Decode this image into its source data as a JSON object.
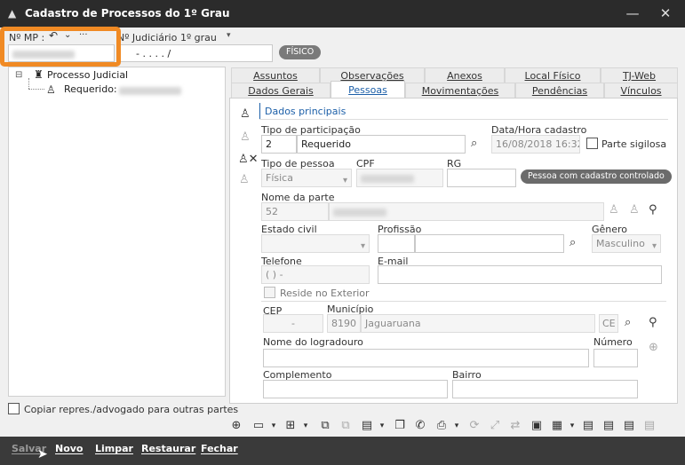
{
  "window": {
    "title": "Cadastro de Processos do 1º Grau",
    "minimize_icon": "minimize-icon",
    "close_icon": "close-icon"
  },
  "header": {
    "mp_label": "Nº MP :",
    "judiciario_label": "Nº Judiciário",
    "grau_value": "1º grau",
    "judiciario_value": "- .  . . .  /",
    "fisico_badge": "FÍSICO"
  },
  "tree": {
    "root": "Processo Judicial",
    "child_label": "Requerido:"
  },
  "tabs_row1": [
    "Assuntos",
    "Observações",
    "Anexos",
    "Local Físico",
    "TJ-Web"
  ],
  "tabs_row2": [
    "Dados Gerais",
    "Pessoas",
    "Movimentações",
    "Pendências",
    "Vínculos"
  ],
  "active_tab": "Pessoas",
  "section": {
    "title": "Dados principais"
  },
  "form": {
    "tipo_participacao_label": "Tipo de participação",
    "tipo_participacao_code": "2",
    "tipo_participacao_value": "Requerido",
    "data_cadastro_label": "Data/Hora cadastro",
    "data_cadastro_value": "16/08/2018 16:32",
    "parte_sigilosa_label": "Parte sigilosa",
    "tipo_pessoa_label": "Tipo de pessoa",
    "tipo_pessoa_value": "Física",
    "cpf_label": "CPF",
    "rg_label": "RG",
    "pessoa_controlada_badge": "Pessoa com cadastro controlado",
    "nome_parte_label": "Nome da parte",
    "nome_parte_code": "52",
    "estado_civil_label": "Estado civil",
    "profissao_label": "Profissão",
    "genero_label": "Gênero",
    "genero_value": "Masculino",
    "telefone_label": "Telefone",
    "telefone_value": "(  )     -",
    "email_label": "E-mail",
    "reside_exterior_label": "Reside no Exterior",
    "cep_label": "CEP",
    "cep_value": "-",
    "municipio_label": "Município",
    "municipio_code": "8190",
    "municipio_value": "Jaguaruana",
    "uf_value": "CE",
    "logradouro_label": "Nome do logradouro",
    "numero_label": "Número",
    "complemento_label": "Complemento",
    "bairro_label": "Bairro"
  },
  "copy_checkbox_label": "Copiar repres./advogado para outras partes",
  "bottom_buttons": [
    "Salvar",
    "Novo",
    "Limpar",
    "Restaurar",
    "Fechar"
  ],
  "colors": {
    "accent": "#1c5fa8",
    "highlight": "#f08a24",
    "titlebar": "#2b2b2b",
    "bottombar": "#3a3a3a"
  }
}
